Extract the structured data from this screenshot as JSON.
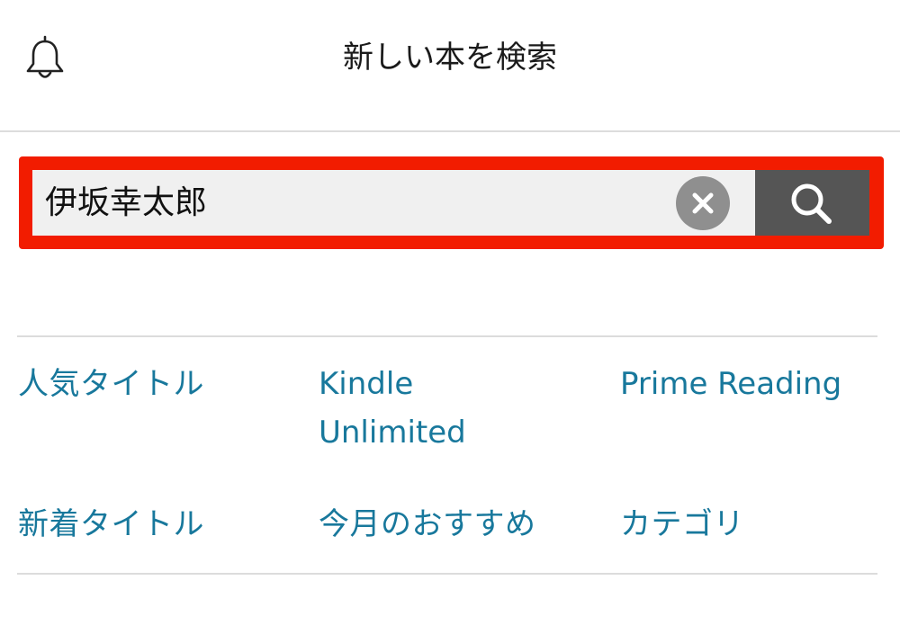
{
  "header": {
    "title": "新しい本を検索",
    "bell_icon": "bell-icon"
  },
  "search": {
    "query": "伊坂幸太郎",
    "clear_icon": "clear-icon",
    "search_icon": "search-icon",
    "highlight_color": "#f21c00"
  },
  "links": {
    "popular": "人気タイトル",
    "kindle_unlimited_line1": "Kindle",
    "kindle_unlimited_line2": "Unlimited",
    "prime_reading": "Prime Reading",
    "new_titles": "新着タイトル",
    "monthly_picks": "今月のおすすめ",
    "categories": "カテゴリ"
  },
  "colors": {
    "link": "#18789c",
    "search_button": "#555555"
  }
}
